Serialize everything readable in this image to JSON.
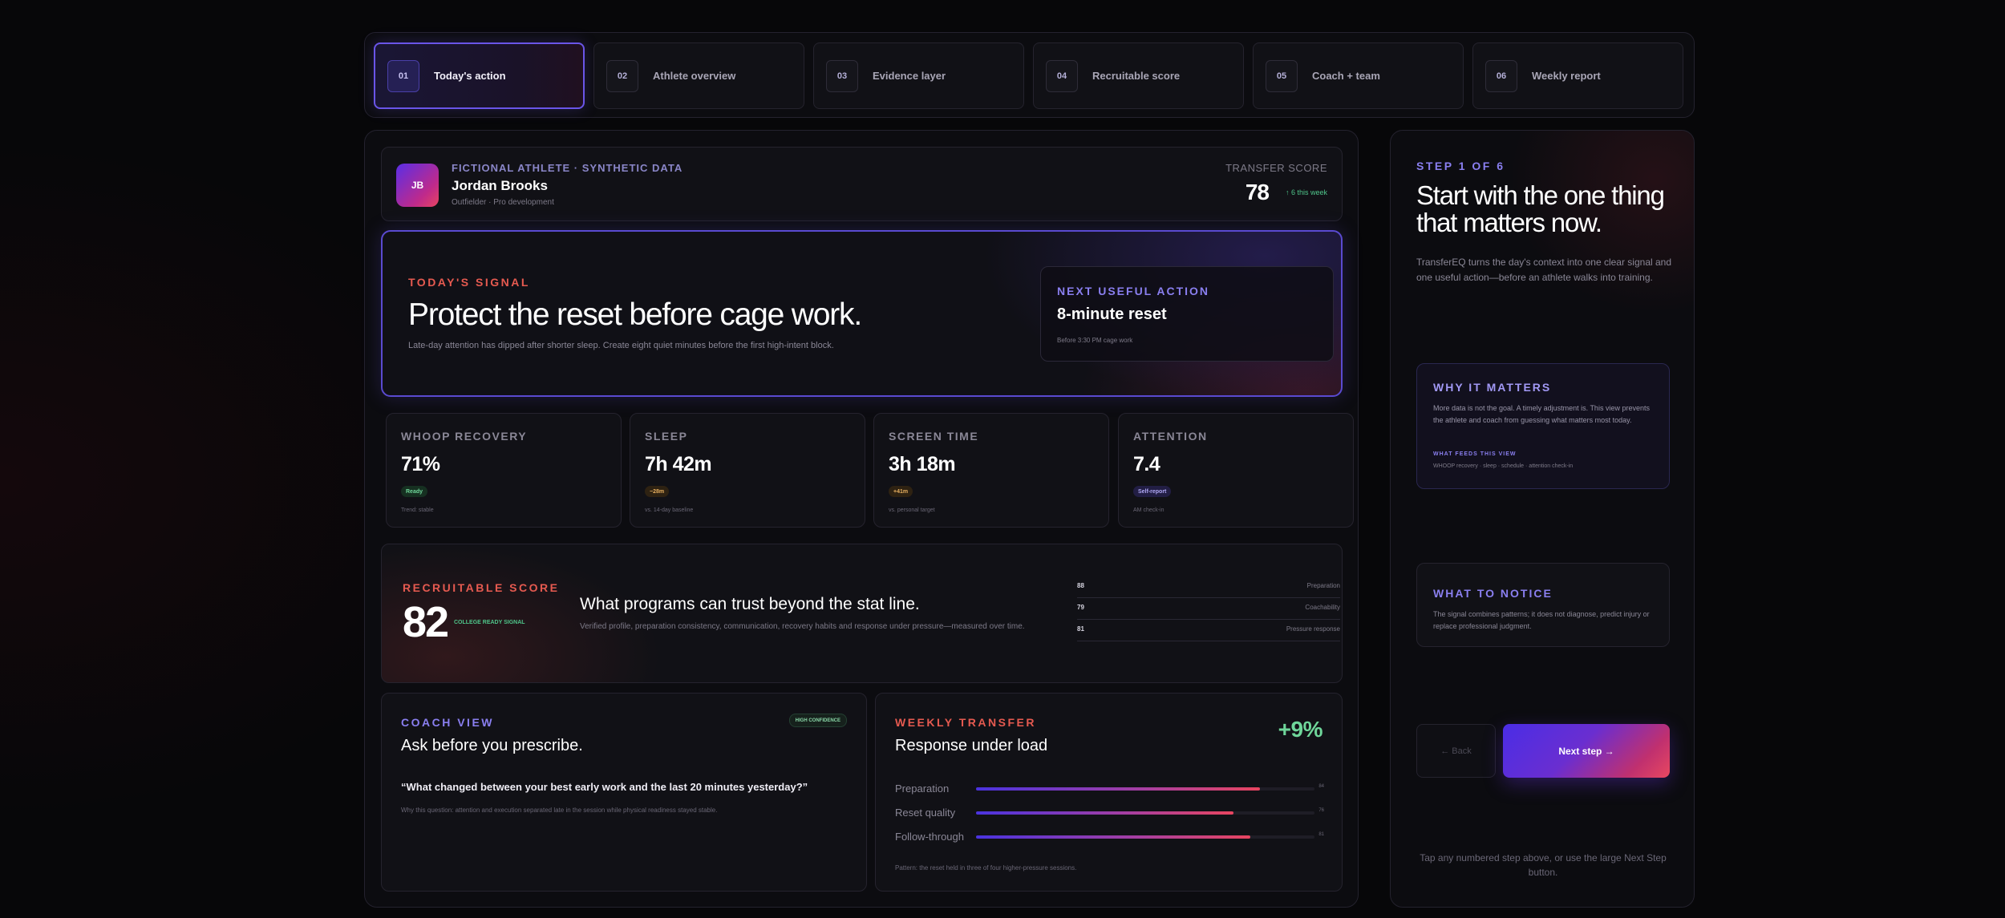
{
  "steps": [
    {
      "num": "01",
      "label": "Today's action"
    },
    {
      "num": "02",
      "label": "Athlete overview"
    },
    {
      "num": "03",
      "label": "Evidence layer"
    },
    {
      "num": "04",
      "label": "Recruitable score"
    },
    {
      "num": "05",
      "label": "Coach + team"
    },
    {
      "num": "06",
      "label": "Weekly report"
    }
  ],
  "athlete": {
    "initials": "JB",
    "tag": "FICTIONAL ATHLETE · SYNTHETIC DATA",
    "name": "Jordan Brooks",
    "role": "Outfielder · Pro development",
    "score_label": "TRANSFER SCORE",
    "score": "78",
    "score_delta": "↑ 6 this week"
  },
  "signal": {
    "eyebrow": "TODAY'S SIGNAL",
    "title": "Protect the reset before cage work.",
    "subtitle": "Late-day attention has dipped after shorter sleep. Create eight quiet minutes before the first high-intent block.",
    "action_eyebrow": "NEXT USEFUL ACTION",
    "action_title": "8-minute reset",
    "action_sub": "Before 3:30 PM cage work"
  },
  "metrics": [
    {
      "label": "WHOOP RECOVERY",
      "value": "71%",
      "pill": "Ready",
      "note": "Trend: stable"
    },
    {
      "label": "SLEEP",
      "value": "7h 42m",
      "pill": "−28m",
      "note": "vs. 14-day baseline"
    },
    {
      "label": "SCREEN TIME",
      "value": "3h 18m",
      "pill": "+41m",
      "note": "vs. personal target"
    },
    {
      "label": "ATTENTION",
      "value": "7.4",
      "pill": "Self-report",
      "note": "AM check-in"
    }
  ],
  "recruit": {
    "eyebrow": "RECRUITABLE SCORE",
    "score": "82",
    "tag": "COLLEGE READY SIGNAL",
    "title": "What programs can trust beyond the stat line.",
    "subtitle": "Verified profile, preparation consistency, communication, recovery habits and response under pressure—measured over time.",
    "rows": [
      {
        "value": "88",
        "label": "Preparation"
      },
      {
        "value": "79",
        "label": "Coachability"
      },
      {
        "value": "81",
        "label": "Pressure response"
      }
    ]
  },
  "coach": {
    "eyebrow": "COACH VIEW",
    "badge": "HIGH CONFIDENCE",
    "title": "Ask before you prescribe.",
    "question": "“What changed between your best early work and the last 20 minutes yesterday?”",
    "note": "Why this question: attention and execution separated late in the session while physical readiness stayed stable."
  },
  "weekly": {
    "eyebrow": "WEEKLY TRANSFER",
    "title": "Response under load",
    "delta": "+9%",
    "bars": [
      {
        "label": "Preparation",
        "value": 84,
        "display": "84"
      },
      {
        "label": "Reset quality",
        "value": 76,
        "display": "76"
      },
      {
        "label": "Follow-through",
        "value": 81,
        "display": "81"
      }
    ],
    "note": "Pattern: the reset held in three of four higher-pressure sessions."
  },
  "side": {
    "step": "STEP 1 OF 6",
    "title": "Start with the one thing that matters now.",
    "subtitle": "TransferEQ turns the day's context into one clear signal and one useful action—before an athlete walks into training.",
    "why_eyebrow": "WHY IT MATTERS",
    "why_body": "More data is not the goal. A timely adjustment is. This view prevents the athlete and coach from guessing what matters most today.",
    "why_feeds_label": "WHAT FEEDS THIS VIEW",
    "why_feeds": "WHOOP recovery · sleep · schedule · attention check-in",
    "notice_eyebrow": "WHAT TO NOTICE",
    "notice_body": "The signal combines patterns; it does not diagnose, predict injury or replace professional judgment.",
    "back_label": "← Back",
    "next_label": "Next step →",
    "footer": "Tap any numbered step above, or use the large Next Step button."
  },
  "colors": {
    "accent_purple": "#6a55e8",
    "accent_red": "#e65a50",
    "positive_green": "#4fc58a"
  }
}
